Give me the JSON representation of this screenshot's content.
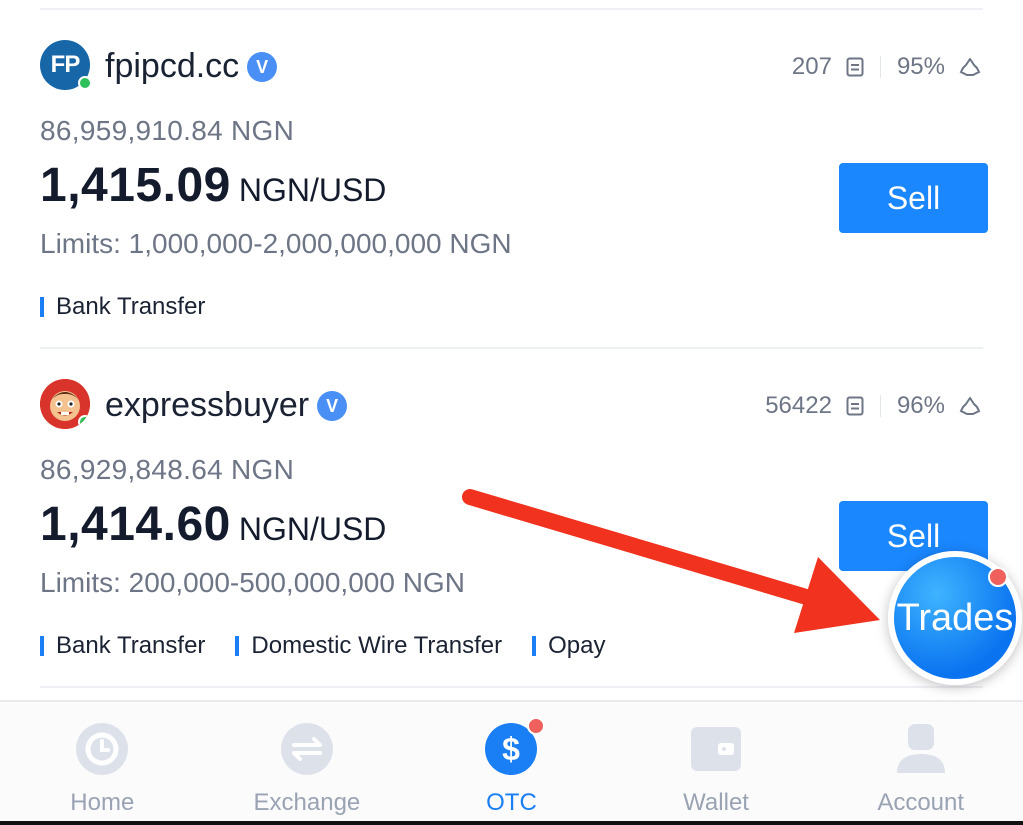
{
  "listings": [
    {
      "merchant": "fpipcd.cc",
      "avatar_text": "FP",
      "verified_label": "V",
      "orders": "207",
      "completion": "95%",
      "available": "86,959,910.84  NGN",
      "price": "1,415.09",
      "unit": "NGN/USD",
      "limits": "Limits: 1,000,000-2,000,000,000 NGN",
      "payments": [
        "Bank Transfer"
      ],
      "action_label": "Sell"
    },
    {
      "merchant": "expressbuyer",
      "verified_label": "V",
      "orders": "56422",
      "completion": "96%",
      "available": "86,929,848.64  NGN",
      "price": "1,414.60",
      "unit": "NGN/USD",
      "limits": "Limits: 200,000-500,000,000 NGN",
      "payments": [
        "Bank Transfer",
        "Domestic Wire Transfer",
        "Opay"
      ],
      "action_label": "Sell"
    }
  ],
  "trades_button": {
    "label": "Trades",
    "has_notification": true
  },
  "bottom_nav": {
    "active": "OTC",
    "items": [
      {
        "label": "Home",
        "icon": "clock-icon"
      },
      {
        "label": "Exchange",
        "icon": "swap-arrows-icon"
      },
      {
        "label": "OTC",
        "icon": "dollar-icon",
        "has_notification": true
      },
      {
        "label": "Wallet",
        "icon": "wallet-icon"
      },
      {
        "label": "Account",
        "icon": "user-icon"
      }
    ]
  },
  "colors": {
    "accent": "#1a87ff",
    "active_nav": "#1a7ff5",
    "badge": "#f0605d",
    "online": "#2ec05a",
    "annotation_arrow": "#f0321e"
  }
}
